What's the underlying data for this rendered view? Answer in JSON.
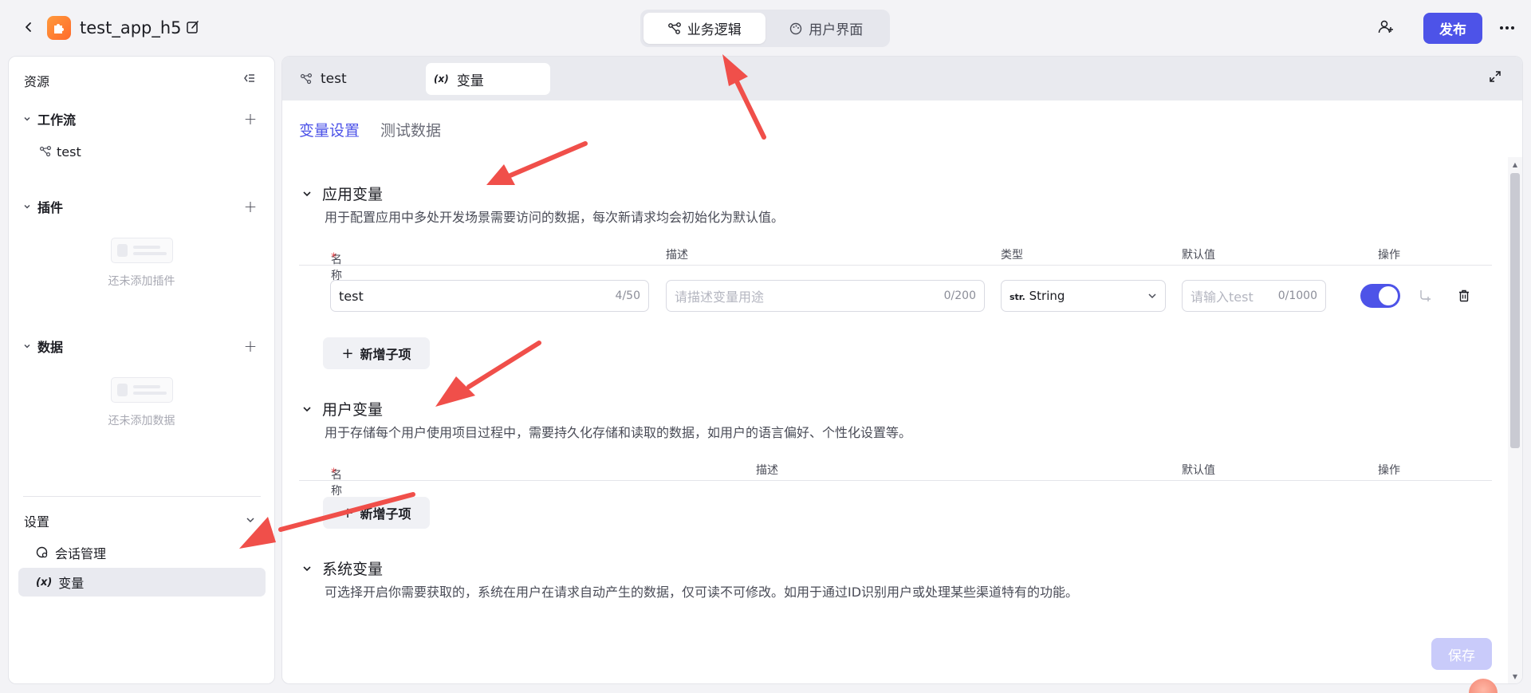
{
  "topbar": {
    "app_title": "test_app_h5",
    "modes": [
      {
        "label": "业务逻辑",
        "active": true
      },
      {
        "label": "用户界面",
        "active": false
      }
    ],
    "publish_label": "发布"
  },
  "sidebar": {
    "title": "资源",
    "groups": [
      {
        "label": "工作流",
        "items": [
          "test"
        ]
      },
      {
        "label": "插件",
        "empty_text": "还未添加插件"
      },
      {
        "label": "数据",
        "empty_text": "还未添加数据"
      }
    ],
    "settings": {
      "title": "设置",
      "items": [
        {
          "label": "会话管理",
          "active": false
        },
        {
          "label": "变量",
          "active": true
        }
      ]
    }
  },
  "main": {
    "file_tabs": [
      {
        "label": "test",
        "active": false
      },
      {
        "label": "变量",
        "active": true
      }
    ],
    "subtabs": [
      {
        "label": "变量设置",
        "active": true
      },
      {
        "label": "测试数据",
        "active": false
      }
    ],
    "app_vars": {
      "title": "应用变量",
      "desc": "用于配置应用中多处开发场景需要访问的数据，每次新请求均会初始化为默认值。",
      "columns": {
        "name": "名称",
        "desc": "描述",
        "type": "类型",
        "default": "默认值",
        "ops": "操作"
      },
      "row": {
        "name": "test",
        "name_count": "4/50",
        "desc_placeholder": "请描述变量用途",
        "desc_count": "0/200",
        "type_prefix": "str.",
        "type": "String",
        "default_placeholder": "请输入test",
        "default_count": "0/1000",
        "enabled": true
      },
      "add_label": "新增子项"
    },
    "user_vars": {
      "title": "用户变量",
      "desc": "用于存储每个用户使用项目过程中，需要持久化存储和读取的数据，如用户的语言偏好、个性化设置等。",
      "columns": {
        "name": "名称",
        "desc": "描述",
        "default": "默认值",
        "ops": "操作"
      },
      "add_label": "新增子项"
    },
    "sys_vars": {
      "title": "系统变量",
      "desc": "可选择开启你需要获取的，系统在用户在请求自动产生的数据，仅可读不可修改。如用于通过ID识别用户或处理某些渠道特有的功能。"
    },
    "save_label": "保存"
  },
  "colors": {
    "accent": "#4d53e8",
    "annotation_arrow": "#f04f4a",
    "required": "#e5484d"
  }
}
